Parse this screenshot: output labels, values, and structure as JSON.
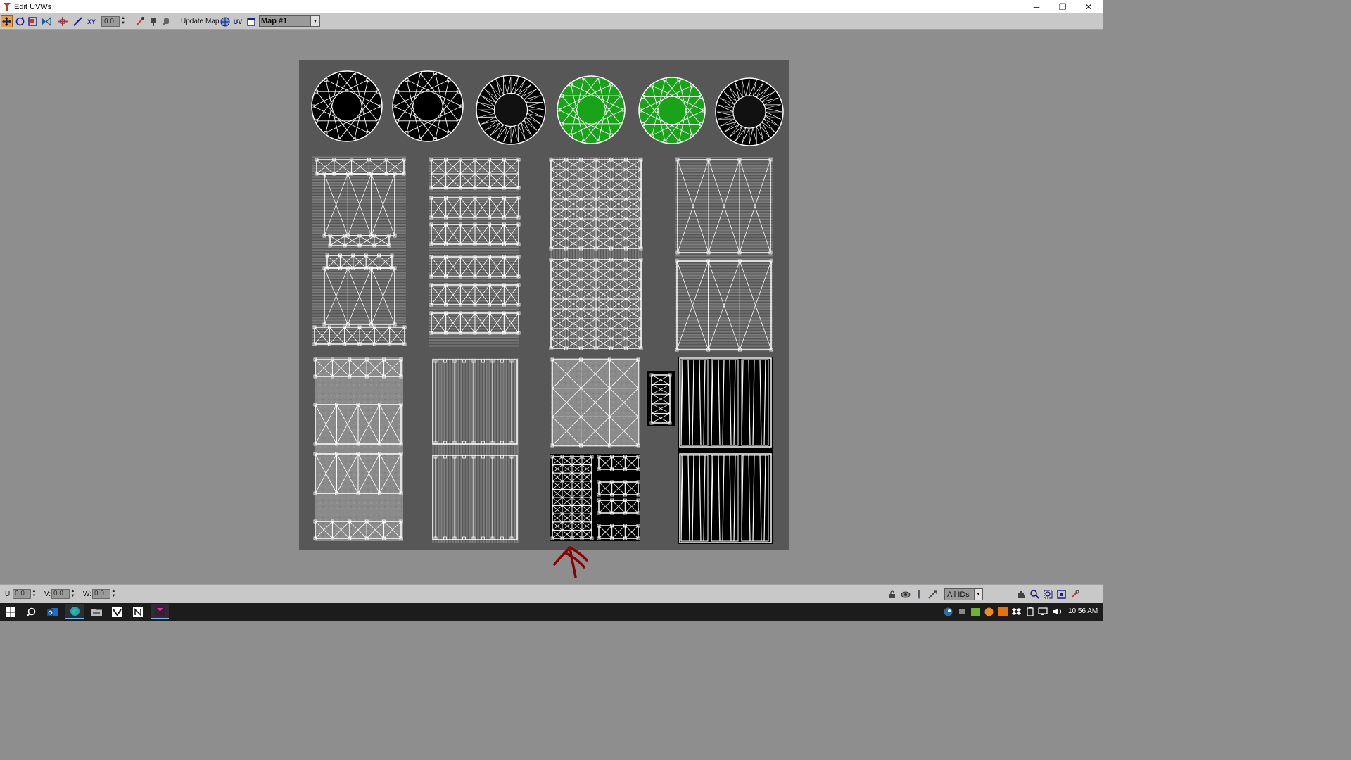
{
  "window": {
    "title": "Edit UVWs",
    "controls": {
      "minimize": "─",
      "restore": "❐",
      "close": "✕"
    }
  },
  "toolbar": {
    "spinner_value": "0.0",
    "update_map_label": "Update Map",
    "map_select_value": "Map #1",
    "icons": [
      "move-icon",
      "rotate-icon",
      "scale-icon",
      "mirror-icon",
      "freeform-icon",
      "pen-icon",
      "uv-axis-icon",
      "pick-icon",
      "paint-icon",
      "pan-small-icon",
      "texture-globe-icon",
      "uv-label-icon",
      "display-icon"
    ]
  },
  "texture_view": {
    "description_colors": {
      "background": "#575757",
      "wire": "#ffffff",
      "selected_fill": "#19a319"
    }
  },
  "status_bar": {
    "u_label": "U:",
    "u_value": "0.0",
    "v_label": "V:",
    "v_value": "0.0",
    "w_label": "W:",
    "w_value": "0.0",
    "ids_select_value": "All IDs",
    "icons": [
      "lock-icon",
      "hide-icon",
      "freeze-icon",
      "filter-icon",
      "pan-icon",
      "zoom-icon",
      "zoom-region-icon",
      "zoom-extents-icon",
      "snap-icon"
    ]
  },
  "taskbar": {
    "apps": [
      "start-icon",
      "search-icon",
      "outlook-icon",
      "edge-icon",
      "folder-icon",
      "mail-icon",
      "notion-icon",
      "3dsmax-icon"
    ],
    "clock": "10:56 AM"
  },
  "annotation": {
    "color": "#8b0000"
  }
}
